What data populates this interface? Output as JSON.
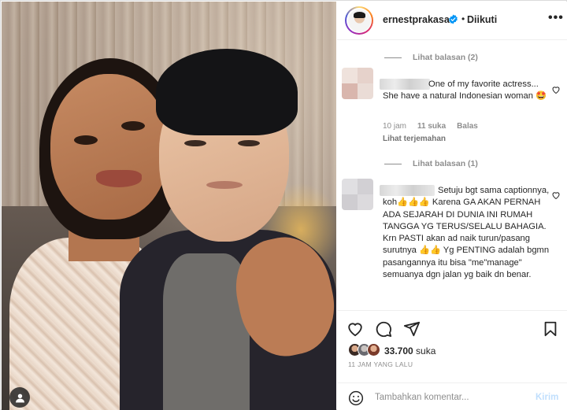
{
  "post": {
    "username": "ernestprakasa",
    "separator": "•",
    "follow_status": "Diikuti",
    "more_label": "•••"
  },
  "comments": [
    {
      "view_replies": "Lihat balasan (2)",
      "text": "One of my favorite actress... She have a natural Indonesian woman 🤩",
      "time": "10 jam",
      "likes": "11 suka",
      "reply": "Balas",
      "translate": "Lihat terjemahan"
    },
    {
      "view_replies": "Lihat balasan (1)",
      "text": "Setuju bgt sama captionnya, koh👍👍👍 Karena GA AKAN PERNAH ADA SEJARAH DI DUNIA INI RUMAH TANGGA YG TERUS/SELALU BAHAGIA. Krn PASTI akan ad naik turun/pasang surutnya 👍👍 Yg PENTING adalah bgmn pasangannya itu bisa \"me\"manage\" semuanya dgn jalan yg baik dn benar."
    }
  ],
  "actions": {
    "likes_count": "33.700",
    "likes_label": "suka",
    "timestamp": "11 JAM YANG LALU"
  },
  "add_comment": {
    "placeholder": "Tambahkan komentar...",
    "post_label": "Kirim"
  },
  "icons": {
    "verified": "verified-badge-icon",
    "heart": "heart-icon",
    "comment": "comment-icon",
    "share": "share-icon",
    "save": "bookmark-icon",
    "emoji": "emoji-icon",
    "user_tag": "user-tag-icon"
  },
  "colors": {
    "verified_blue": "#0095f6",
    "muted_text": "#8e8e8e",
    "post_button_disabled": "#c0dffd"
  }
}
